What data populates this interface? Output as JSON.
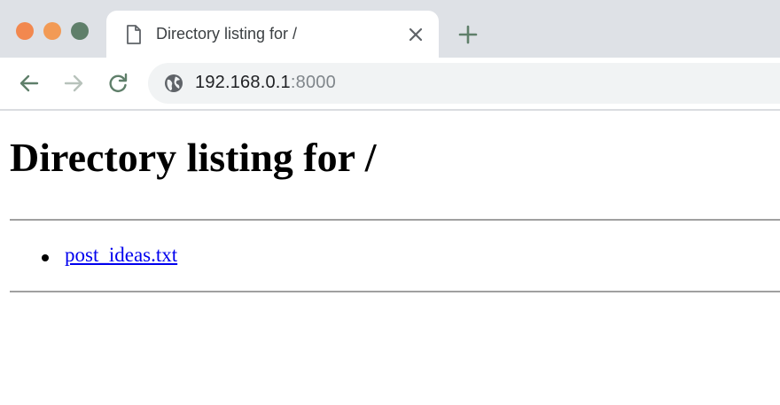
{
  "browser": {
    "window_controls": {
      "close_color": "#f2884f",
      "minimize_color": "#f29a55",
      "maximize_color": "#5f7f6a"
    },
    "tab": {
      "title": "Directory listing for /"
    },
    "address_bar": {
      "host": "192.168.0.1",
      "port": ":8000"
    },
    "icon_color": "#5f7f6a"
  },
  "page": {
    "heading": "Directory listing for /",
    "files": [
      {
        "name": "post_ideas.txt"
      }
    ],
    "link_color": "#0000ee"
  }
}
